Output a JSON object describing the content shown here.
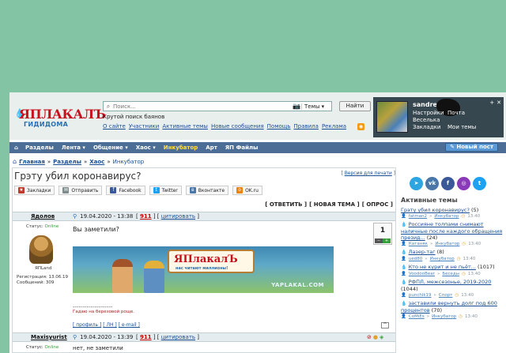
{
  "header": {
    "logo_text": "ЯПЛАКАЛЪ",
    "logo_sub": "ГИДИДОМА",
    "search_placeholder": "Поиск...",
    "search_scope": "Темы",
    "find_button": "Найти",
    "tagline": "Крутой поиск баянов",
    "links": [
      "О сайте",
      "Участники",
      "Активные темы",
      "Новые сообщения",
      "Помощь",
      "Правила",
      "Реклама"
    ]
  },
  "user": {
    "name": "sandre",
    "links": [
      "Настройки",
      "Почта",
      "Веселька",
      "",
      "Закладки",
      "Мои темы"
    ],
    "icons": [
      "+",
      "✕"
    ]
  },
  "nav": {
    "items": [
      "Разделы",
      "Лента",
      "Общение",
      "Хаос",
      "Инкубатор",
      "Арт",
      "ЯП Файлы"
    ],
    "new_post": "Новый пост"
  },
  "breadcrumb": {
    "items": [
      "Главная",
      "Разделы",
      "Хаос"
    ],
    "current": "Инкубатор"
  },
  "topic": {
    "title": "Грэту убил коронавирус?",
    "print_label": "Версия для печати",
    "share": [
      {
        "label": "Закладки",
        "icon": "bookmark-icon",
        "color": "#c0392b"
      },
      {
        "label": "Отправить",
        "icon": "mail-icon",
        "color": "#7f8c8d"
      },
      {
        "label": "Facebook",
        "icon": "facebook-icon",
        "color": "#3b5998"
      },
      {
        "label": "Twitter",
        "icon": "twitter-icon",
        "color": "#1da1f2"
      },
      {
        "label": "Вконтакте",
        "icon": "vk-icon",
        "color": "#4a76a8"
      },
      {
        "label": "OK.ru",
        "icon": "ok-icon",
        "color": "#ee8208"
      }
    ],
    "actions": [
      "[ ОТВЕТИТЬ ]",
      "[ НОВАЯ ТЕМА ]",
      "[ ОПРОС ]"
    ]
  },
  "posts": [
    {
      "author": "Ядолов",
      "date": "19.04.2020 - 13:38",
      "number": "911",
      "quote_label": "цитировать",
      "status_label": "Статус:",
      "status": "Online",
      "rank": "ЯПLand",
      "registered": "Регистрация: 13.06.19",
      "messages": "Сообщений: 309",
      "text": "Вы заметили?",
      "banner_title": "ЯПлакалЪ",
      "banner_sub": "нас читают миллионы!",
      "banner_watermark": "YAPLAKAL.COM",
      "sig_line": "--------------------",
      "signature": "Гадаю на березовой роще.",
      "footer": [
        "[ профиль ]",
        "[ ЛН ]",
        "[ e-mail ]"
      ],
      "rating": "1",
      "vote_minus": "−",
      "vote_plus": "+",
      "totop": "^"
    },
    {
      "author": "Maxisyurist",
      "date": "19.04.2020 - 13:39",
      "number": "911",
      "quote_label": "цитировать",
      "status_label": "Статус:",
      "status": "Online",
      "text": "нет, не заметили"
    }
  ],
  "sidebar": {
    "social": [
      {
        "icon": "telegram-icon",
        "glyph": "➤",
        "color": "#2ca5e0"
      },
      {
        "icon": "vk-icon",
        "glyph": "vk",
        "color": "#4a76a8"
      },
      {
        "icon": "facebook-icon",
        "glyph": "f",
        "color": "#3b5998"
      },
      {
        "icon": "instagram-icon",
        "glyph": "◎",
        "color": "#8a3ab9"
      },
      {
        "icon": "twitter-icon",
        "glyph": "t",
        "color": "#1da1f2"
      }
    ],
    "header": "Активные темы",
    "topics": [
      {
        "title": "Грэту убил коронавирус?",
        "count": "(5)",
        "user": "fatman2",
        "board": "Инкубатор",
        "time": "13:40"
      },
      {
        "title": "Россияне толпами снимают наличные после каждого обращения презид...",
        "count": "(24)",
        "user": "Катаняк",
        "board": "Инкубатор",
        "time": "13:40"
      },
      {
        "title": "Лазер-таг",
        "count": "(8)",
        "user": "ued80",
        "board": "Инкубатор",
        "time": "13:40"
      },
      {
        "title": "Кто не курит и не пьёт...",
        "count": "(1017)",
        "user": "VoodooBear",
        "board": "Беседы",
        "time": "13:40"
      },
      {
        "title": "РФПЛ, межсезонье, 2019-2020",
        "count": "(1044)",
        "user": "punchik19",
        "board": "Спорт",
        "time": "13:40"
      },
      {
        "title": "заставили вернуть долг под 600 процентов",
        "count": "(70)",
        "user": "CoMiEs",
        "board": "Инкубатор",
        "time": "13:40"
      }
    ]
  }
}
